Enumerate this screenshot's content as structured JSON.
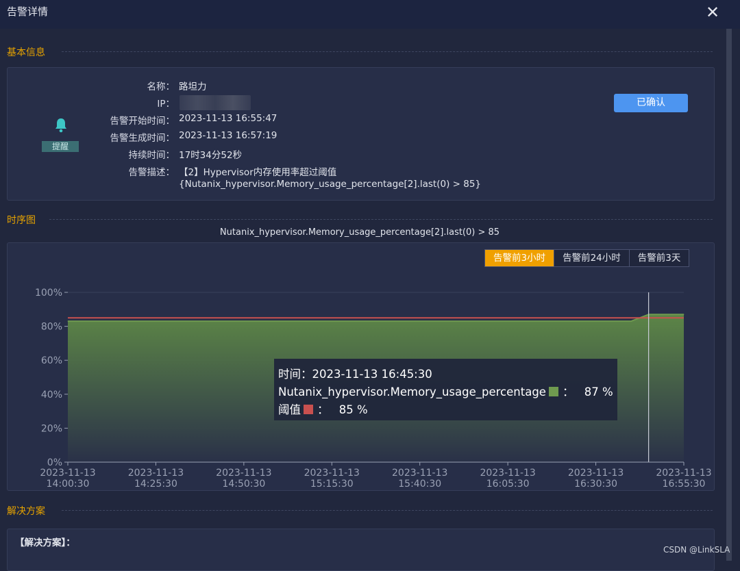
{
  "window": {
    "title": "告警详情",
    "close_icon": "close-icon"
  },
  "sections": {
    "basic_info": "基本信息",
    "timeseries": "时序图",
    "solution": "解决方案"
  },
  "alert": {
    "severity_badge": "提醒",
    "severity_icon": "bell-icon",
    "confirm_button": "已确认",
    "fields": [
      {
        "label": "名称：",
        "value": "路坦力"
      },
      {
        "label": "IP：",
        "value": ""
      },
      {
        "label": "告警开始时间：",
        "value": "2023-11-13 16:55:47"
      },
      {
        "label": "告警生成时间：",
        "value": "2023-11-13 16:57:19"
      },
      {
        "label": "持续时间：",
        "value": "17时34分52秒"
      },
      {
        "label": "告警描述：",
        "value": "【2】Hypervisor内存使用率超过阈值"
      }
    ],
    "description_line2": "{Nutanix_hypervisor.Memory_usage_percentage[2].last(0) > 85}"
  },
  "chart_header": {
    "title": "Nutanix_hypervisor.Memory_usage_percentage[2].last(0) > 85",
    "range_tabs": [
      "告警前3小时",
      "告警前24小时",
      "告警前3天"
    ],
    "active_range": "告警前3小时"
  },
  "tooltip": {
    "time_label": "时间：",
    "time_value": "2023-11-13 16:45:30",
    "series_label": "Nutanix_hypervisor.Memory_usage_percentage",
    "series_value": "87 %",
    "threshold_label": "阈值",
    "threshold_value": "85 %",
    "separator": "："
  },
  "chart_data": {
    "type": "area",
    "x_ticks": [
      [
        "2023-11-13",
        "14:00:30"
      ],
      [
        "2023-11-13",
        "14:25:30"
      ],
      [
        "2023-11-13",
        "14:50:30"
      ],
      [
        "2023-11-13",
        "15:15:30"
      ],
      [
        "2023-11-13",
        "15:40:30"
      ],
      [
        "2023-11-13",
        "16:05:30"
      ],
      [
        "2023-11-13",
        "16:30:30"
      ],
      [
        "2023-11-13",
        "16:55:30"
      ]
    ],
    "x_minutes_range": [
      0,
      175
    ],
    "y_ticks": [
      "0%",
      "20%",
      "40%",
      "60%",
      "80%",
      "100%"
    ],
    "ylim": [
      0,
      100
    ],
    "series": [
      {
        "name": "Nutanix_hypervisor.Memory_usage_percentage",
        "color": "#6f9a4f",
        "points": [
          [
            0,
            83
          ],
          [
            160,
            83
          ],
          [
            165,
            87
          ],
          [
            175,
            87
          ]
        ]
      },
      {
        "name": "阈值",
        "color": "#c8504f",
        "points": [
          [
            0,
            85
          ],
          [
            175,
            85
          ]
        ]
      }
    ],
    "cursor_x": 165
  },
  "solution": {
    "heading": "【解决方案】："
  },
  "watermark": "CSDN @LinkSLA"
}
